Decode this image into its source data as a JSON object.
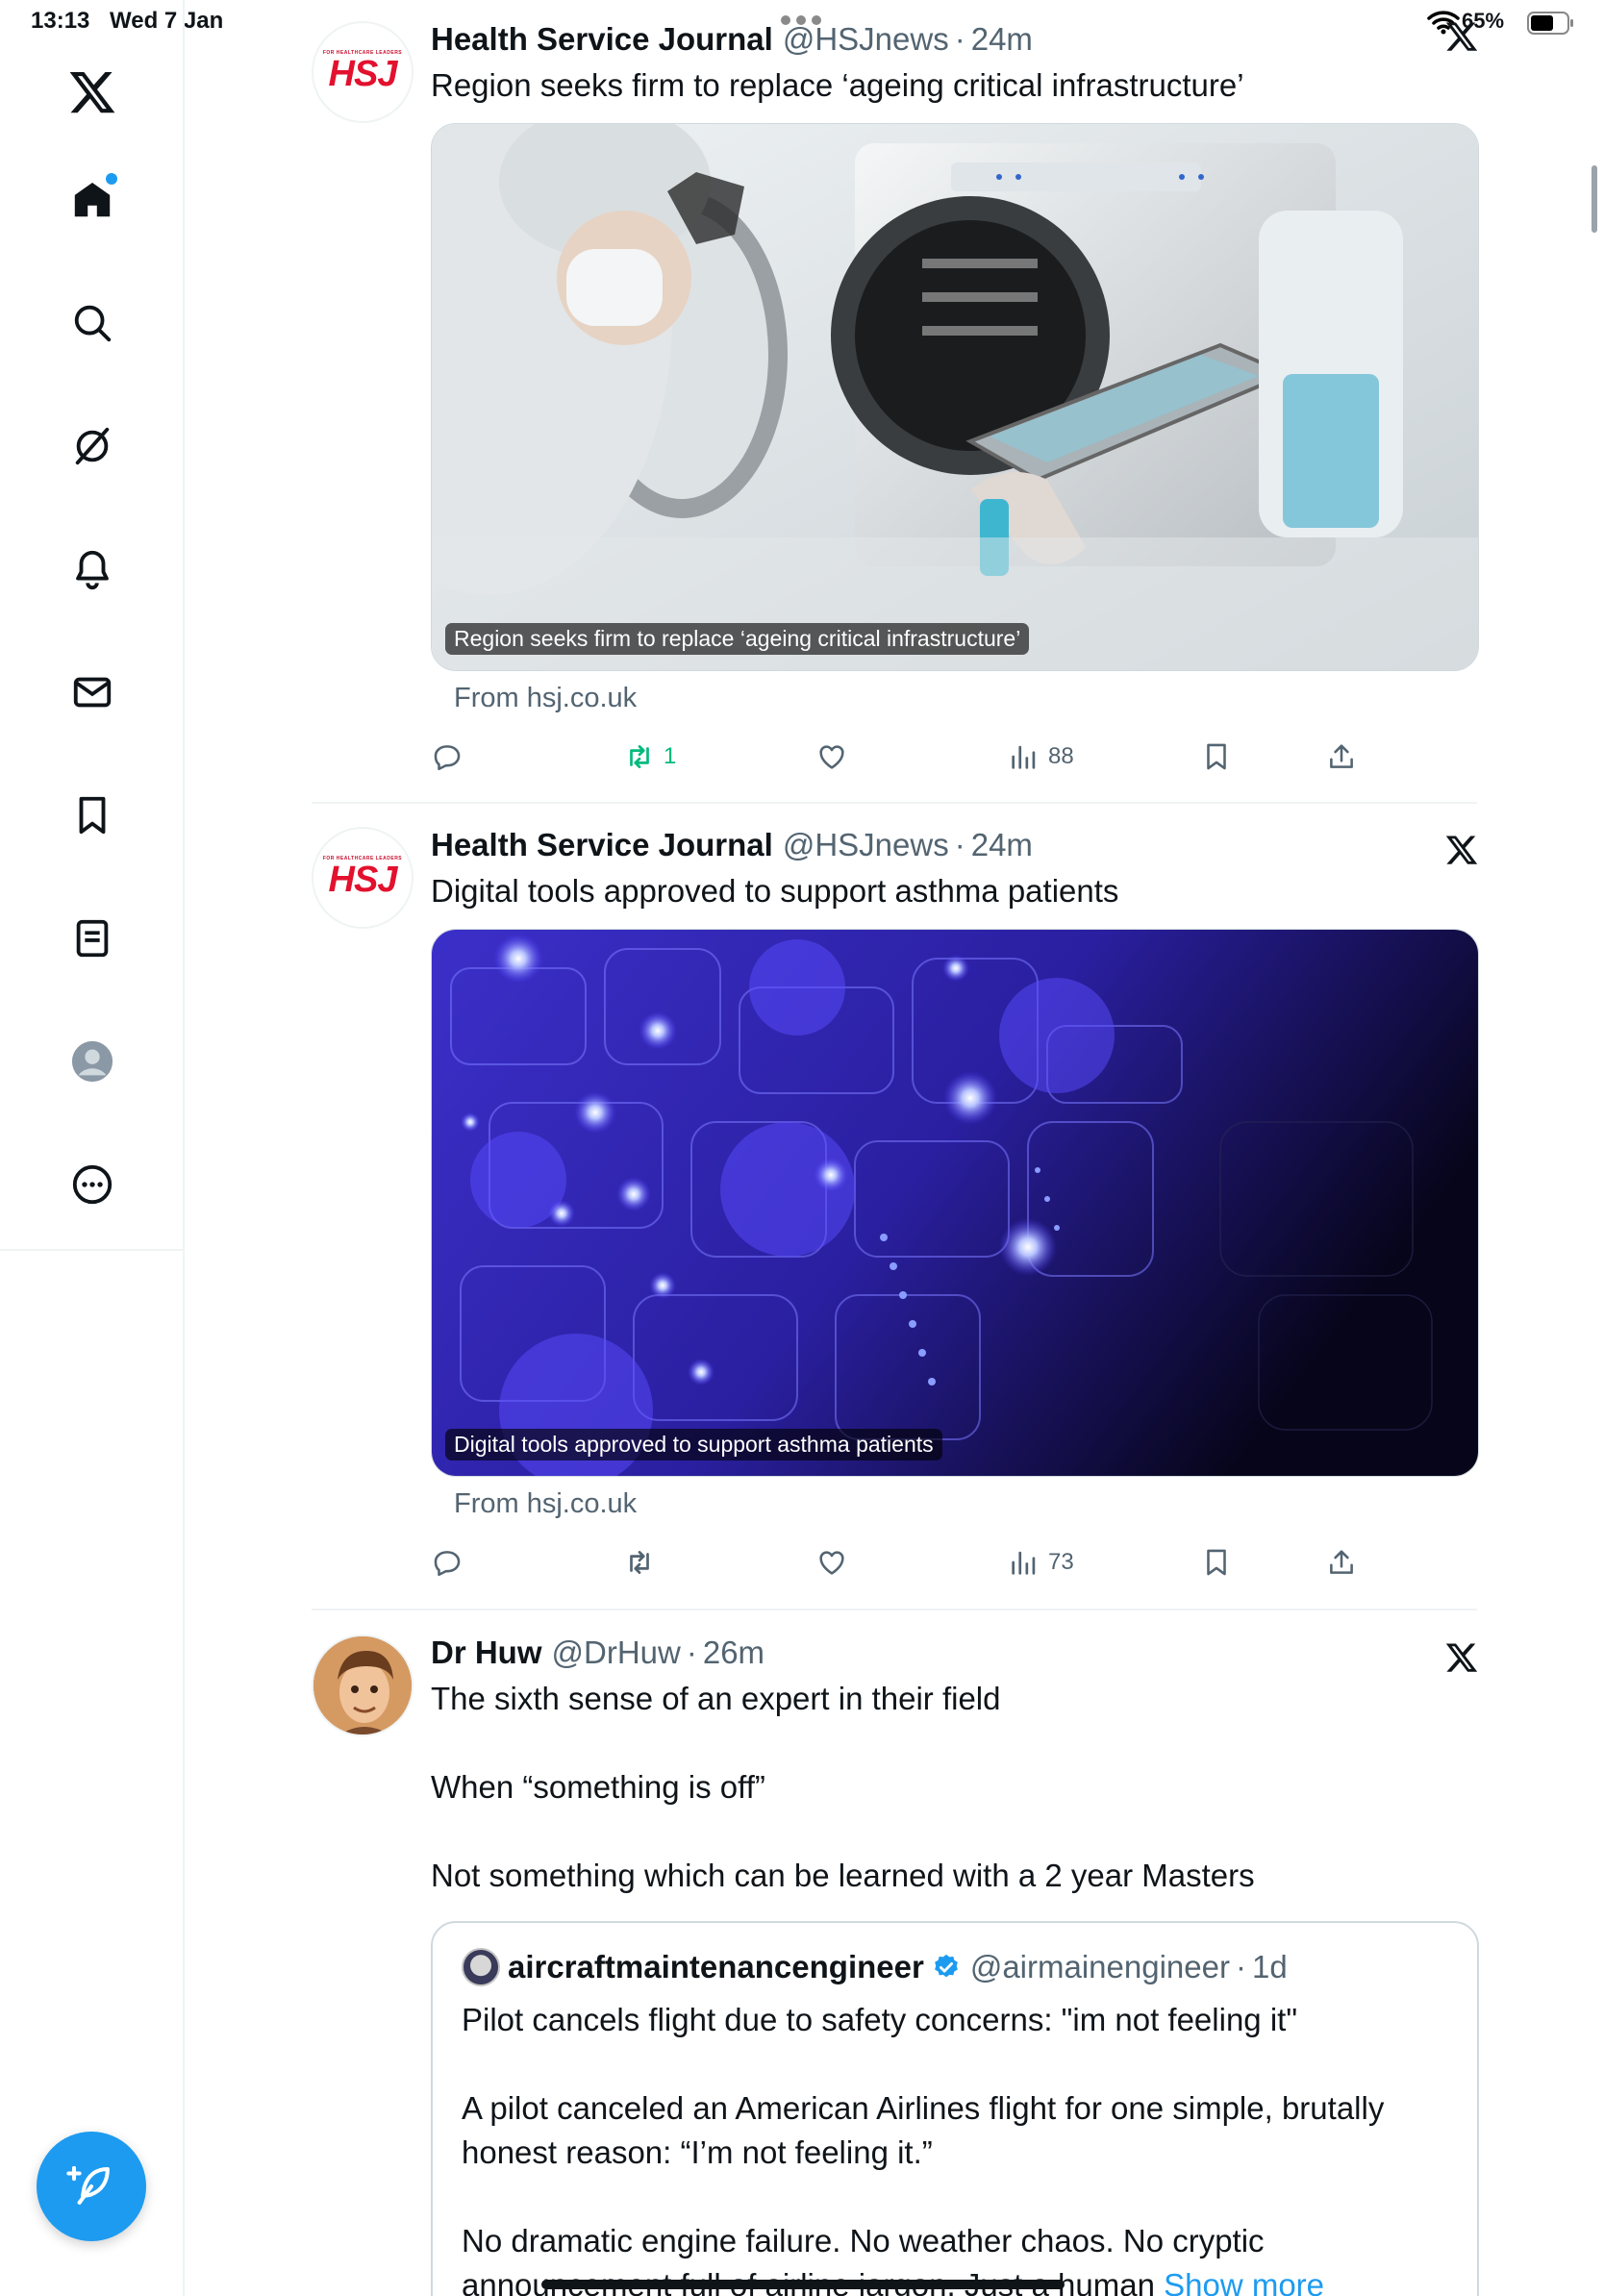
{
  "status_bar": {
    "time": "13:13",
    "date": "Wed 7 Jan",
    "battery": "65%",
    "battery_level": 0.65
  },
  "sidebar": {
    "items": [
      {
        "name": "home",
        "label": "Home",
        "has_notification": true
      },
      {
        "name": "search",
        "label": "Explore"
      },
      {
        "name": "grok",
        "label": "Grok"
      },
      {
        "name": "notifications",
        "label": "Notifications"
      },
      {
        "name": "messages",
        "label": "Messages"
      },
      {
        "name": "bookmarks",
        "label": "Bookmarks"
      },
      {
        "name": "lists",
        "label": "Lists"
      },
      {
        "name": "profile",
        "label": "Profile"
      },
      {
        "name": "more",
        "label": "More"
      }
    ],
    "compose_label": "Post",
    "accent_color": "#1d9bf0"
  },
  "posts": [
    {
      "author": "Health Service Journal",
      "handle": "@HSJnews",
      "time": "24m",
      "text": "Region seeks firm to replace ‘ageing critical infrastructure’",
      "avatar_logo": "HSJ",
      "avatar_tagline": "FOR HEALTHCARE LEADERS",
      "media_caption": "Region seeks firm to replace ‘ageing critical infrastructure’",
      "source": "From hsj.co.uk",
      "reposts": "1",
      "views": "88"
    },
    {
      "author": "Health Service Journal",
      "handle": "@HSJnews",
      "time": "24m",
      "text": "Digital tools approved to support asthma patients",
      "avatar_logo": "HSJ",
      "avatar_tagline": "FOR HEALTHCARE LEADERS",
      "media_caption": "Digital tools approved to support asthma patients",
      "source": "From hsj.co.uk",
      "reposts": "",
      "views": "73"
    },
    {
      "author": "Dr Huw",
      "handle": "@DrHuw",
      "time": "26m",
      "text_lines": [
        "The sixth sense of an expert in their field",
        "When “something is off”",
        "Not something which can be learned with a 2 year Masters"
      ],
      "quote": {
        "author": "aircraftmaintenancengineer",
        "handle": "@airmainengineer",
        "time": "1d",
        "verified": true,
        "paragraphs": [
          "Pilot cancels flight due to safety concerns: \"im not feeling it\"",
          "A pilot canceled an American Airlines flight for one simple, brutally honest reason: “I’m not feeling it.”",
          "No dramatic engine failure. No weather chaos. No cryptic announcement full of airline jargon. Just a human"
        ],
        "show_more": "Show more"
      }
    }
  ]
}
